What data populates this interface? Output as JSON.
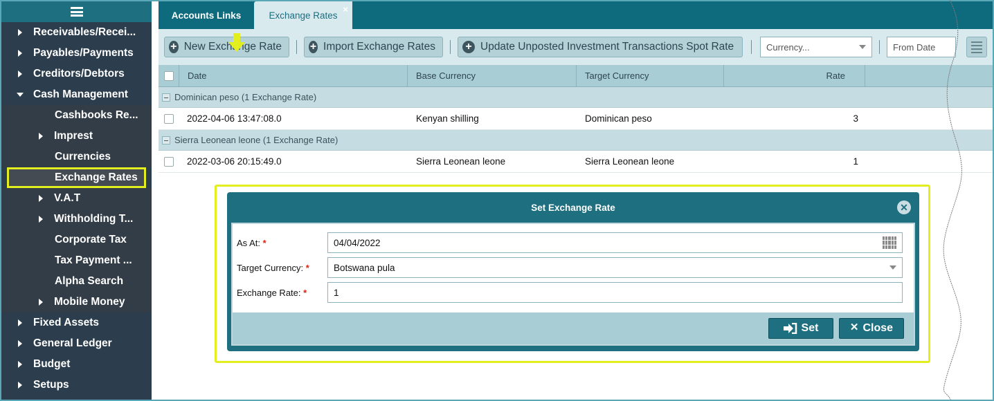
{
  "sidebar": {
    "items": [
      {
        "label": "Receivables/Recei...",
        "level": 0,
        "arrow": "right"
      },
      {
        "label": "Payables/Payments",
        "level": 0,
        "arrow": "right"
      },
      {
        "label": "Creditors/Debtors",
        "level": 0,
        "arrow": "right"
      },
      {
        "label": "Cash Management",
        "level": 0,
        "arrow": "down"
      },
      {
        "label": "Cashbooks Re...",
        "level": 1,
        "arrow": "none"
      },
      {
        "label": "Imprest",
        "level": 1,
        "arrow": "right"
      },
      {
        "label": "Currencies",
        "level": 1,
        "arrow": "none"
      },
      {
        "label": "Exchange Rates",
        "level": 1,
        "arrow": "none",
        "active": true
      },
      {
        "label": "V.A.T",
        "level": 1,
        "arrow": "right"
      },
      {
        "label": "Withholding T...",
        "level": 1,
        "arrow": "right"
      },
      {
        "label": "Corporate Tax",
        "level": 1,
        "arrow": "none"
      },
      {
        "label": "Tax Payment ...",
        "level": 1,
        "arrow": "none"
      },
      {
        "label": "Alpha Search",
        "level": 1,
        "arrow": "none"
      },
      {
        "label": "Mobile Money",
        "level": 1,
        "arrow": "right"
      },
      {
        "label": "Fixed Assets",
        "level": 0,
        "arrow": "right"
      },
      {
        "label": "General Ledger",
        "level": 0,
        "arrow": "right"
      },
      {
        "label": "Budget",
        "level": 0,
        "arrow": "right"
      },
      {
        "label": "Setups",
        "level": 0,
        "arrow": "right"
      }
    ]
  },
  "tabs": [
    {
      "label": "Accounts Links",
      "active": false
    },
    {
      "label": "Exchange Rates",
      "active": true,
      "close": "×"
    }
  ],
  "toolbar": {
    "new_label": "New Exchange Rate",
    "import_label": "Import Exchange Rates",
    "update_label": "Update Unposted Investment Transactions Spot Rate",
    "currency_placeholder": "Currency...",
    "from_date_placeholder": "From Date"
  },
  "grid": {
    "columns": [
      "Date",
      "Base Currency",
      "Target Currency",
      "Rate"
    ],
    "groups": [
      {
        "label": "Dominican peso (1 Exchange Rate)",
        "rows": [
          {
            "date": "2022-04-06 13:47:08.0",
            "base": "Kenyan shilling",
            "target": "Dominican peso",
            "rate": "3"
          }
        ]
      },
      {
        "label": "Sierra Leonean leone (1 Exchange Rate)",
        "rows": [
          {
            "date": "2022-03-06 20:15:49.0",
            "base": "Sierra Leonean leone",
            "target": "Sierra Leonean leone",
            "rate": "1"
          }
        ]
      }
    ]
  },
  "dialog": {
    "title": "Set Exchange Rate",
    "fields": [
      {
        "label": "As At:",
        "required": "*",
        "value": "04/04/2022",
        "icon": "calendar-icon"
      },
      {
        "label": "Target Currency:",
        "required": "*",
        "value": "Botswana pula",
        "icon": "chevron-down-icon"
      },
      {
        "label": "Exchange Rate:",
        "required": "*",
        "value": "1",
        "icon": ""
      }
    ],
    "set_label": "Set",
    "close_label": "Close"
  },
  "colors": {
    "accent": "#1e6f7f",
    "highlight": "#e3ee1f",
    "sidebar_bg": "#2c3e4d"
  }
}
